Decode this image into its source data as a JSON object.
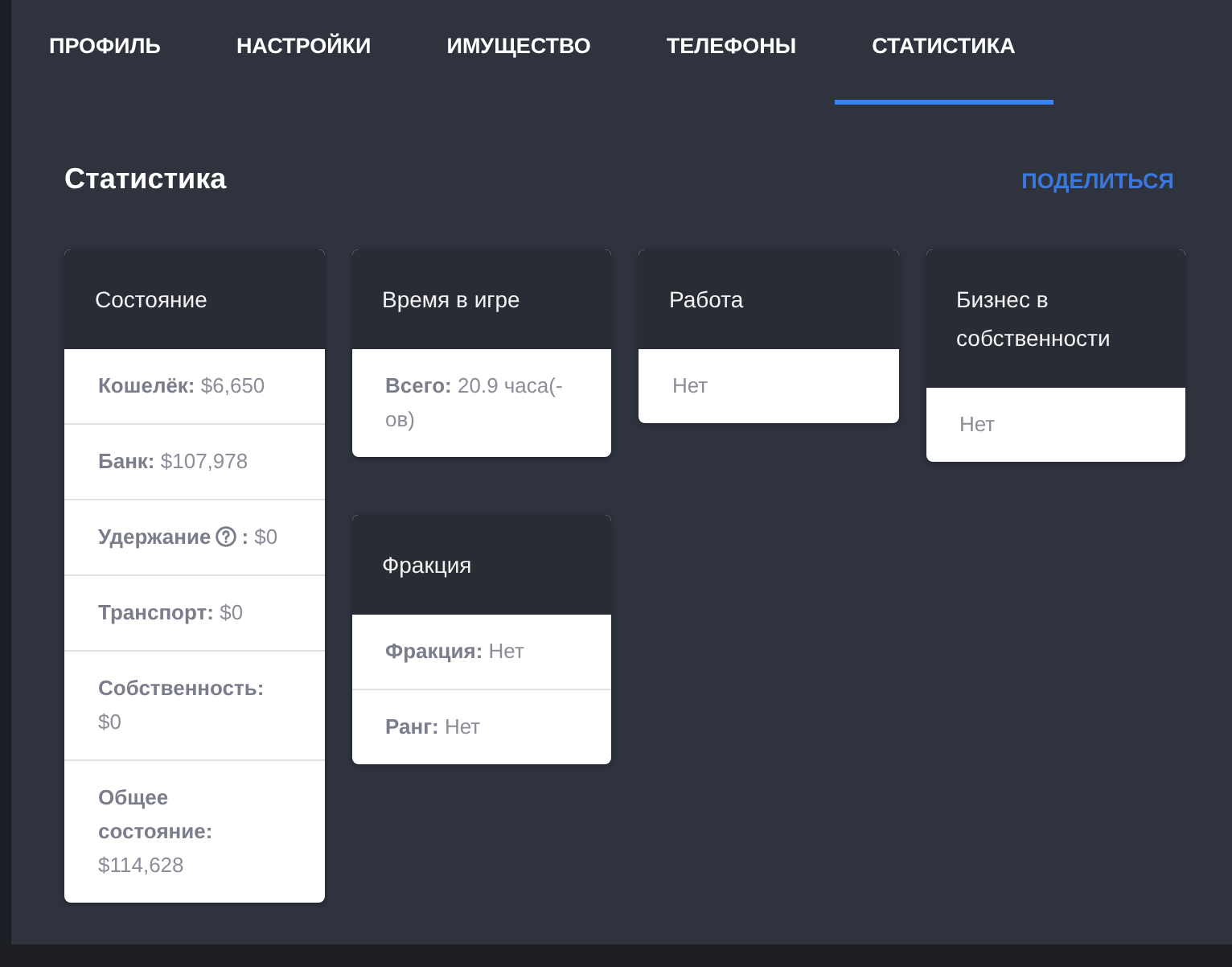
{
  "tabs": [
    {
      "label": "ПРОФИЛЬ",
      "selected": false
    },
    {
      "label": "НАСТРОЙКИ",
      "selected": false
    },
    {
      "label": "ИМУЩЕСТВО",
      "selected": false
    },
    {
      "label": "ТЕЛЕФОНЫ",
      "selected": false
    },
    {
      "label": "СТАТИСТИКА",
      "selected": true
    }
  ],
  "section": {
    "title": "Статистика",
    "share_button": "ПОДЕЛИТЬСЯ"
  },
  "card_columns": [
    [
      {
        "title": "Состояние",
        "rows": [
          {
            "label": "Кошелёк:",
            "value": "$6,650"
          },
          {
            "label": "Банк:",
            "value": "$107,978"
          },
          {
            "label": "Удержание",
            "help": true,
            "label_end": ":",
            "value": "$0"
          },
          {
            "label": "Транспорт:",
            "value": "$0"
          },
          {
            "label": "Собственность:",
            "value": "$0"
          },
          {
            "label": "Общее состояние:",
            "value": "$114,628"
          }
        ]
      }
    ],
    [
      {
        "title": "Время в игре",
        "rows": [
          {
            "label": "Всего:",
            "value": "20.9 часа(-ов)"
          }
        ]
      },
      {
        "title": "Фракция",
        "rows": [
          {
            "label": "Фракция:",
            "value": "Нет"
          },
          {
            "label": "Ранг:",
            "value": "Нет"
          }
        ]
      }
    ],
    [
      {
        "title": "Работа",
        "rows": [
          {
            "value": "Нет"
          }
        ]
      }
    ],
    [
      {
        "title": "Бизнес в собственности",
        "rows": [
          {
            "value": "Нет"
          }
        ]
      }
    ]
  ]
}
